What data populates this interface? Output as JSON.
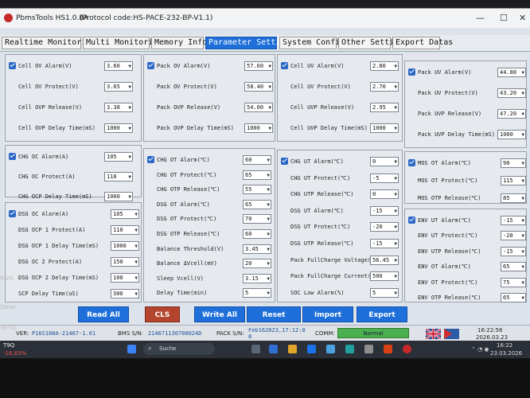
{
  "window": {
    "app_title": "PbmsTools HS1.0.8A",
    "protocol_code": "(Protocol code:HS-PACE-232-BP-V1.1)",
    "min": "—",
    "max": "☐",
    "close": "✕"
  },
  "tabs": [
    "Realtime Monitoring",
    "Multi Monitoring",
    "Memory Info.",
    "Parameter Setting",
    "System Config.",
    "Other Setting",
    "Export Datas"
  ],
  "groups": {
    "cell_ov": [
      {
        "label": "Cell OV Alarm(V)",
        "value": "3.60",
        "check": true
      },
      {
        "label": "Cell OV Protect(V)",
        "value": "3.65"
      },
      {
        "label": "Cell OVP Release(V)",
        "value": "3.38"
      },
      {
        "label": "Cell OVP Delay Time(mS)",
        "value": "1000"
      }
    ],
    "pack_ov": [
      {
        "label": "Pack OV Alarm(V)",
        "value": "57.60",
        "check": true
      },
      {
        "label": "Pack OV Protect(V)",
        "value": "58.40"
      },
      {
        "label": "Pack OVP Release(V)",
        "value": "54.00"
      },
      {
        "label": "Pack OVP Delay Time(mS)",
        "value": "1000"
      }
    ],
    "cell_uv": [
      {
        "label": "Cell UV Alarm(V)",
        "value": "2.80",
        "check": true
      },
      {
        "label": "Cell UV Protect(V)",
        "value": "2.70"
      },
      {
        "label": "Cell UVP Release(V)",
        "value": "2.95"
      },
      {
        "label": "Cell UVP Delay Time(mS)",
        "value": "1000"
      }
    ],
    "pack_uv": [
      {
        "label": "Pack UV Alarm(V)",
        "value": "44.80",
        "check": true
      },
      {
        "label": "Pack UV Protect(V)",
        "value": "43.20"
      },
      {
        "label": "Pack UVP Release(V)",
        "value": "47.20"
      },
      {
        "label": "Pack UVP Delay Time(mS)",
        "value": "1000"
      }
    ],
    "chg_oc": [
      {
        "label": "CHG OC Alarm(A)",
        "value": "105",
        "check": true
      },
      {
        "label": "CHG OC Protect(A)",
        "value": "110"
      },
      {
        "label": "CHG OCP Delay Time(mS)",
        "value": "1000"
      }
    ],
    "dsg_oc": [
      {
        "label": "DSG OC Alarm(A)",
        "value": "105",
        "check": true
      },
      {
        "label": "DSG OCP 1 Protect(A)",
        "value": "110"
      },
      {
        "label": "DSG OCP 1 Delay Time(mS)",
        "value": "1000"
      },
      {
        "label": "DSG OC 2 Protect(A)",
        "value": "150"
      },
      {
        "label": "DSG OCP 2 Delay Time(mS)",
        "value": "100"
      },
      {
        "label": "SCP Delay Time(uS)",
        "value": "300"
      }
    ],
    "temp_ot": [
      {
        "label": "CHG OT Alarm(℃)",
        "value": "60",
        "check": true
      },
      {
        "label": "CHG OT Protect(℃)",
        "value": "65"
      },
      {
        "label": "CHG OTP Release(℃)",
        "value": "55"
      },
      {
        "label": "DSG OT Alarm(℃)",
        "value": "65"
      },
      {
        "label": "DSG OT Protect(℃)",
        "value": "70"
      },
      {
        "label": "DSG OTP Release(℃)",
        "value": "60"
      },
      {
        "label": "Balance Threshold(V)",
        "value": "3.45"
      },
      {
        "label": "Balance ΔVcell(mV)",
        "value": "20"
      },
      {
        "label": "Sleep Vcell(V)",
        "value": "3.15"
      },
      {
        "label": "Delay Time(min)",
        "value": "5"
      }
    ],
    "temp_ut": [
      {
        "label": "CHG UT Alarm(℃)",
        "value": "0",
        "check": true
      },
      {
        "label": "CHG UT Protect(℃)",
        "value": "-5"
      },
      {
        "label": "CHG UTP Release(℃)",
        "value": "0"
      },
      {
        "label": "DSG UT Alarm(℃)",
        "value": "-15"
      },
      {
        "label": "DSG UT Protect(℃)",
        "value": "-20"
      },
      {
        "label": "DSG UTP Release(℃)",
        "value": "-15"
      },
      {
        "label": "Pack FullCharge Voltage(V)",
        "value": "56.45"
      },
      {
        "label": "Pack FullCharge Current(mA)",
        "value": "500"
      },
      {
        "label": "SOC Low Alarm(%)",
        "value": "5"
      }
    ],
    "mos": [
      {
        "label": "MOS OT Alarm(℃)",
        "value": "90",
        "check": true
      },
      {
        "label": "MOS OT Protect(℃)",
        "value": "115"
      },
      {
        "label": "MOS OTP Release(℃)",
        "value": "85"
      }
    ],
    "env": [
      {
        "label": "ENV UT Alarm(℃)",
        "value": "-15",
        "check": true
      },
      {
        "label": "ENV UT Protect(℃)",
        "value": "-20"
      },
      {
        "label": "ENV UTP Release(℃)",
        "value": "-15"
      },
      {
        "label": "ENV OT Alarm(℃)",
        "value": "65"
      },
      {
        "label": "ENV OT Protect(℃)",
        "value": "75"
      },
      {
        "label": "ENV OTP Release(℃)",
        "value": "65"
      }
    ]
  },
  "buttons": {
    "read_all": "Read All",
    "cls": "CLS",
    "write_all": "Write All",
    "reset": "Reset Setting",
    "import": "Import",
    "export": "Export"
  },
  "status": {
    "ver_label": "VER:",
    "ver": "P16S100A-21467-1.01",
    "bms_label": "BMS S/N:",
    "bms": "214671130700024D",
    "pack_label": "PACK S/N:",
    "pack": "Feb162023,17:12:0 8",
    "comm_label": "COMM:",
    "comm": "Normal",
    "time": "16:22:56",
    "date": "2026.03.23"
  },
  "taskbar": {
    "temp": "T9Q",
    "change": "-16,83%",
    "search": "Suche",
    "time": "16:22",
    "date": "23.03.2026"
  },
  "side": [
    "Diese",
    "PAPE",
    "ne Su"
  ],
  "colors": {
    "accent": "#1e6fd9",
    "cls": "#b4442d",
    "comm": "#4caf50"
  }
}
